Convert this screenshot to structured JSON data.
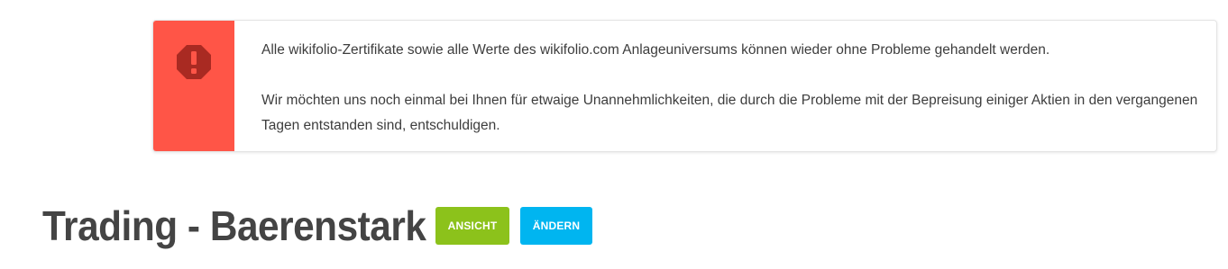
{
  "alert": {
    "icon": "exclamation-octagon-icon",
    "accent_color": "#ff5547",
    "message_line1": "Alle wikifolio-Zertifikate sowie alle Werte des wikifolio.com Anlageuniversums können wieder ohne Probleme gehandelt werden.",
    "message_line2": "Wir möchten uns noch einmal bei Ihnen für etwaige Unannehmlichkeiten, die durch die Probleme mit der Bepreisung einiger Aktien in den vergangenen Tagen entstanden sind, entschuldigen."
  },
  "header": {
    "title": "Trading - Baerenstark",
    "view_button_label": "ANSICHT",
    "edit_button_label": "ÄNDERN",
    "view_button_color": "#8cc21b",
    "edit_button_color": "#00b5f0"
  }
}
